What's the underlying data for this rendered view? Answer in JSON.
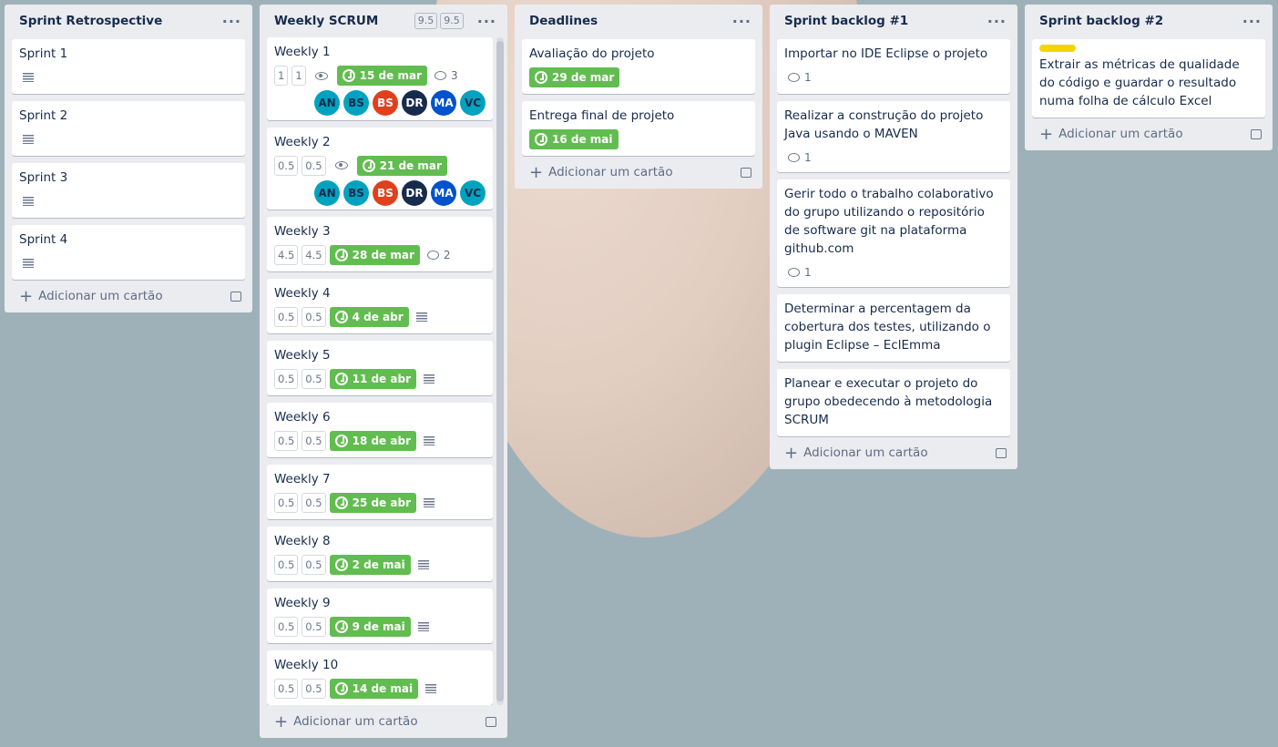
{
  "add_card_label": "Adicionar um cartão",
  "colors": {
    "due": "#61bd4f",
    "label_yellow": "#f2d600",
    "list_bg": "#ebecf0"
  },
  "lists": [
    {
      "title": "Sprint Retrospective",
      "cards": [
        {
          "title": "Sprint 1",
          "desc": true
        },
        {
          "title": "Sprint 2",
          "desc": true
        },
        {
          "title": "Sprint 3",
          "desc": true
        },
        {
          "title": "Sprint 4",
          "desc": true
        }
      ]
    },
    {
      "title": "Weekly SCRUM",
      "estimates": [
        "9.5",
        "9.5"
      ],
      "scroll": true,
      "cards": [
        {
          "title": "Weekly 1",
          "est": [
            "1",
            "1"
          ],
          "watch": true,
          "due": "15 de mar",
          "comments": "3",
          "avatars": [
            "AN",
            "BS",
            "BS",
            "DR",
            "MA",
            "VC"
          ]
        },
        {
          "title": "Weekly 2",
          "est": [
            "0.5",
            "0.5"
          ],
          "watch": true,
          "due": "21 de mar",
          "avatars": [
            "AN",
            "BS",
            "BS",
            "DR",
            "MA",
            "VC"
          ]
        },
        {
          "title": "Weekly 3",
          "est": [
            "4.5",
            "4.5"
          ],
          "due": "28 de mar",
          "comments": "2"
        },
        {
          "title": "Weekly 4",
          "est": [
            "0.5",
            "0.5"
          ],
          "due": "4 de abr",
          "desc": true
        },
        {
          "title": "Weekly 5",
          "est": [
            "0.5",
            "0.5"
          ],
          "due": "11 de abr",
          "desc": true
        },
        {
          "title": "Weekly 6",
          "est": [
            "0.5",
            "0.5"
          ],
          "due": "18 de abr",
          "desc": true
        },
        {
          "title": "Weekly 7",
          "est": [
            "0.5",
            "0.5"
          ],
          "due": "25 de abr",
          "desc": true
        },
        {
          "title": "Weekly 8",
          "est": [
            "0.5",
            "0.5"
          ],
          "due": "2 de mai",
          "desc": true
        },
        {
          "title": "Weekly 9",
          "est": [
            "0.5",
            "0.5"
          ],
          "due": "9 de mai",
          "desc": true
        },
        {
          "title": "Weekly 10",
          "est": [
            "0.5",
            "0.5"
          ],
          "due": "14 de mai",
          "desc": true
        }
      ]
    },
    {
      "title": "Deadlines",
      "cards": [
        {
          "title": "Avaliação do projeto",
          "due": "29 de mar"
        },
        {
          "title": "Entrega final de projeto",
          "due": "16 de mai"
        }
      ]
    },
    {
      "title": "Sprint backlog #1",
      "cards": [
        {
          "title": "Importar no IDE Eclipse o projeto",
          "comments": "1"
        },
        {
          "title": "Realizar a construção do projeto Java usando o MAVEN",
          "comments": "1"
        },
        {
          "title": "Gerir todo o trabalho colaborativo do grupo utilizando o repositório de software git na plataforma github.com",
          "comments": "1"
        },
        {
          "title": "Determinar a percentagem da cobertura dos testes, utilizando o plugin Eclipse – EclEmma"
        },
        {
          "title": "Planear e executar o projeto do grupo obedecendo à metodologia SCRUM"
        }
      ]
    },
    {
      "title": "Sprint backlog #2",
      "cards": [
        {
          "title": "Extrair as métricas de qualidade do código e guardar o resultado numa folha de cálculo Excel",
          "label": "yellow"
        }
      ]
    }
  ],
  "avatar_colors": {
    "AN": [
      "#00a3bf",
      "#172b4d"
    ],
    "BS": [
      "#00a3bf",
      "#172b4d"
    ],
    "BS2": [
      "#e0401b",
      "#ffffff"
    ],
    "DR": [
      "#172b4d",
      "#ffffff"
    ],
    "MA": [
      "#0052cc",
      "#ffffff"
    ],
    "VC": [
      "#00a3bf",
      "#172b4d"
    ]
  }
}
